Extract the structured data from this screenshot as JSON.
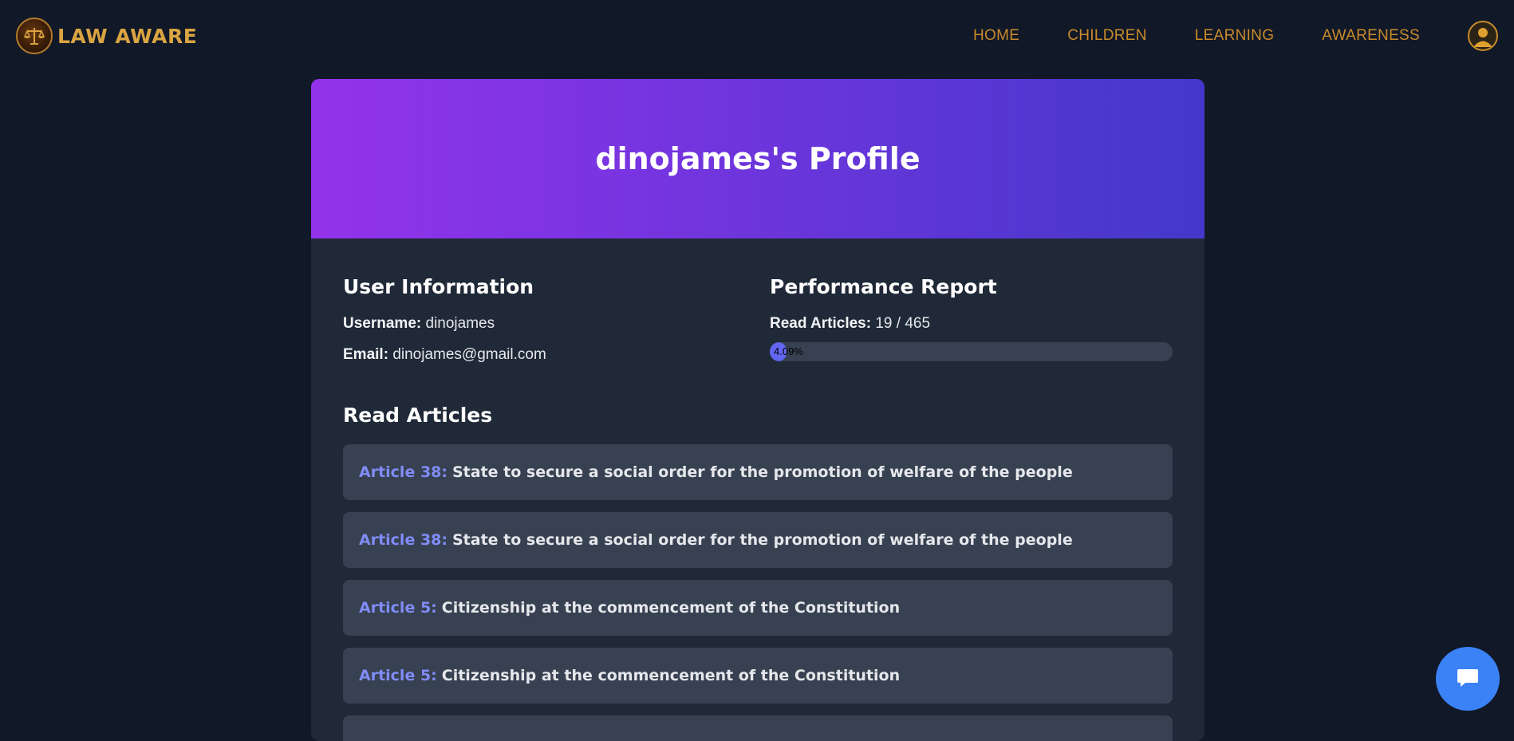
{
  "brand": {
    "name": "LAW AWARE",
    "logo_icon": "scales-of-justice-icon"
  },
  "nav": {
    "links": [
      "HOME",
      "CHILDREN",
      "LEARNING",
      "AWARENESS"
    ],
    "avatar_icon": "user-avatar-icon"
  },
  "profile": {
    "title": "dinojames's Profile",
    "user_info": {
      "heading": "User Information",
      "username_label": "Username:",
      "username": "dinojames",
      "email_label": "Email:",
      "email": "dinojames@gmail.com"
    },
    "performance": {
      "heading": "Performance Report",
      "read_label": "Read Articles:",
      "read_value": "19 / 465",
      "progress_percent": 4.09,
      "progress_text": "4.09%"
    },
    "read_articles": {
      "heading": "Read Articles",
      "items": [
        {
          "number": "Article 38:",
          "title": "State to secure a social order for the promotion of welfare of the people"
        },
        {
          "number": "Article 38:",
          "title": "State to secure a social order for the promotion of welfare of the people"
        },
        {
          "number": "Article 5:",
          "title": "Citizenship at the commencement of the Constitution"
        },
        {
          "number": "Article 5:",
          "title": "Citizenship at the commencement of the Constitution"
        },
        {
          "number": "",
          "title": ""
        }
      ]
    }
  },
  "chat": {
    "icon": "chat-bubble-icon"
  },
  "colors": {
    "background": "#111827",
    "card": "#1f2937",
    "header_gradient_start": "#9333ea",
    "header_gradient_end": "#4338ca",
    "nav_link": "#c98b2a",
    "article_number": "#818cf8",
    "progress_fill": "#6366f1",
    "chat_button": "#3b82f6"
  }
}
